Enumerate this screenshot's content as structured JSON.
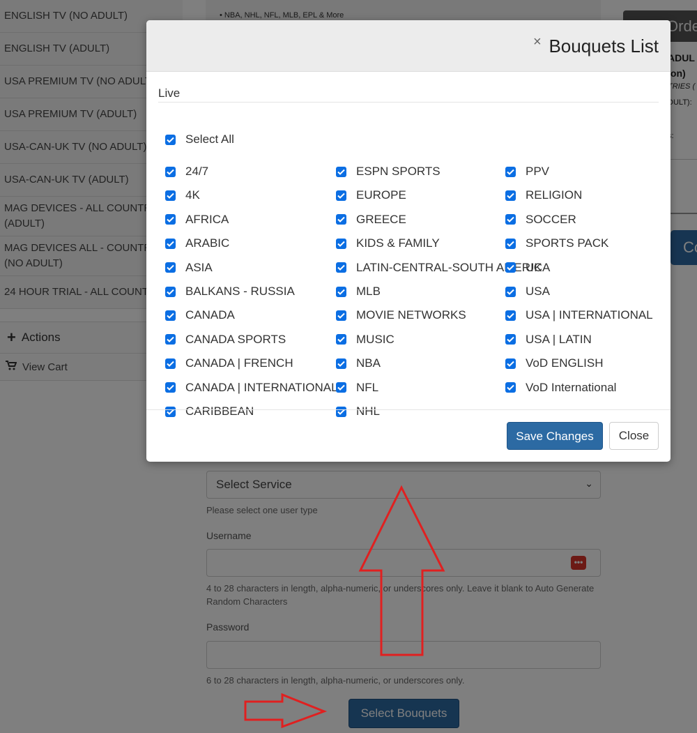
{
  "sidebar": {
    "items": [
      "ENGLISH TV (NO ADULT)",
      "ENGLISH TV (ADULT)",
      "USA PREMIUM TV (NO ADULT",
      "USA PREMIUM TV (ADULT)",
      "USA-CAN-UK TV (NO ADULT)",
      "USA-CAN-UK TV (ADULT)",
      "MAG DEVICES - ALL COUNTRI",
      "(ADULT)",
      "MAG DEVICES ALL - COUNTRI",
      "(NO ADULT)",
      "24 HOUR TRIAL - ALL COUNT"
    ],
    "actions_label": "Actions",
    "view_cart_label": "View Cart"
  },
  "main": {
    "promo_text": "• NBA, NHL, NFL, MLB, EPL & More",
    "select_service_placeholder": "Select Service",
    "select_help": "Please select one user type",
    "username_label": "Username",
    "username_help": "4 to 28 characters in length, alpha-numeric, or underscores only. Leave it blank to Auto Generate Random Characters",
    "password_label": "Password",
    "password_help": "6 to 28 characters in length, alpha-numeric, or underscores only.",
    "select_bouquets_label": "Select Bouquets"
  },
  "right_col": {
    "order_label": "Orde",
    "line1": "ADUL",
    "line2": "ion)",
    "line3": "TRIES (",
    "line4": "DULT):",
    "line5": "s:",
    "blue_btn": "Co"
  },
  "modal": {
    "title": "Bouquets List",
    "close_symbol": "×",
    "group_label": "Live",
    "select_all": "Select All",
    "col1": [
      "24/7",
      "4K",
      "AFRICA",
      "ARABIC",
      "ASIA",
      "BALKANS - RUSSIA",
      "CANADA",
      "CANADA SPORTS",
      "CANADA | FRENCH",
      "CANADA | INTERNATIONAL",
      "CARIBBEAN"
    ],
    "col2": [
      "ESPN SPORTS",
      "EUROPE",
      "GREECE",
      "KIDS & FAMILY",
      "LATIN-CENTRAL-SOUTH AMERICA",
      "MLB",
      "MOVIE NETWORKS",
      "MUSIC",
      "NBA",
      "NFL",
      "NHL"
    ],
    "col3": [
      "PPV",
      "RELIGION",
      "SOCCER",
      "SPORTS PACK",
      "UK",
      "USA",
      "USA | INTERNATIONAL",
      "USA | LATIN",
      "VoD ENGLISH",
      "VoD International"
    ],
    "save_label": "Save Changes",
    "close_label": "Close"
  },
  "colors": {
    "checkbox": "#0b6ee3",
    "primary_button": "#2c6aa3",
    "annotation_arrow": "#e02020"
  }
}
